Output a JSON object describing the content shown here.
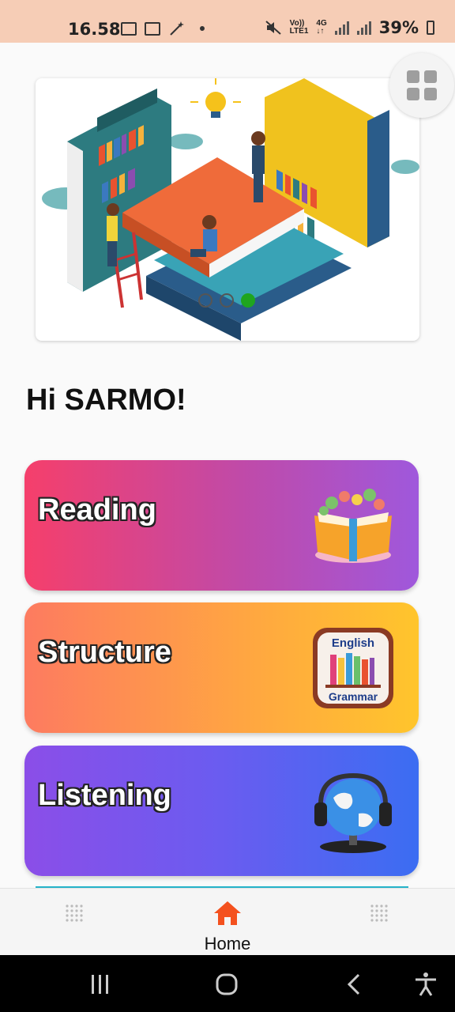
{
  "status_bar": {
    "time": "16.58",
    "network_label_top": "Vo))",
    "network_label_bottom": "LTE1",
    "gen_top": "4G",
    "gen_bottom": "↓↑",
    "battery": "39%",
    "icons": [
      "image-icon",
      "calendar-icon",
      "magic-wand-icon",
      "mute-icon",
      "signal-icon",
      "battery-icon"
    ]
  },
  "banner": {
    "illustration": "books-library-illustration",
    "pages": 3,
    "active_page": 3
  },
  "greeting": "Hi SARMO!",
  "cards": [
    {
      "label": "Reading",
      "icon": "open-book-flowers-icon",
      "gradient": [
        "#f53f6b",
        "#9f58dc"
      ]
    },
    {
      "label": "Structure",
      "icon": "english-grammar-book-icon",
      "icon_text_top": "English",
      "icon_text_bottom": "Grammar",
      "gradient": [
        "#fd7b60",
        "#ffc52c"
      ]
    },
    {
      "label": "Listening",
      "icon": "globe-headphones-icon",
      "gradient": [
        "#8b4ee8",
        "#3b6df2"
      ]
    }
  ],
  "bottom_nav": {
    "home_label": "Home",
    "home_color": "#f4511e"
  },
  "system_nav": [
    "recents-icon",
    "home-circle-icon",
    "back-icon",
    "accessibility-icon"
  ]
}
